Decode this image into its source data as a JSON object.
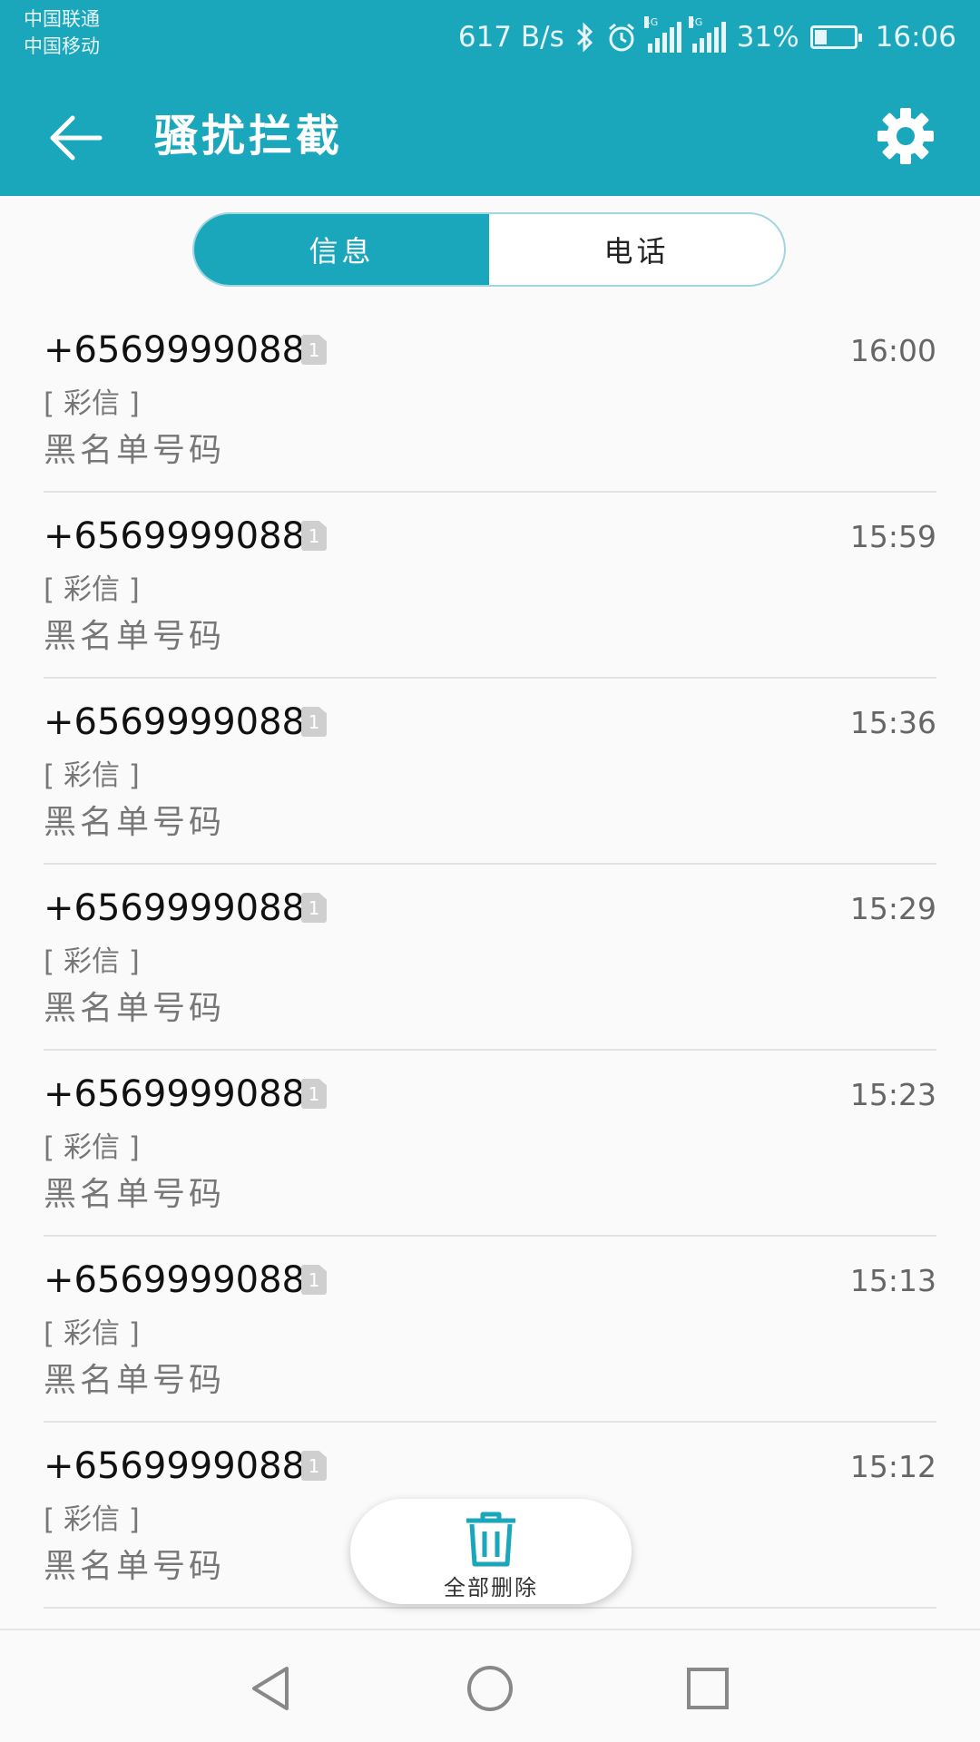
{
  "status_bar": {
    "carrier_1": "中国联通",
    "carrier_2": "中国移动",
    "speed": "617 B/s",
    "net_1": "4G",
    "net_2": "2G",
    "battery": "31%",
    "battery_level": 0.31,
    "time": "16:06",
    "icons": [
      "bluetooth-icon",
      "alarm-icon",
      "signal-icon",
      "battery-icon"
    ]
  },
  "app_bar": {
    "title": "骚扰拦截",
    "back_icon": "arrow-left-icon",
    "settings_icon": "gear-icon"
  },
  "tabs": [
    {
      "label": "信息",
      "selected": true
    },
    {
      "label": "电话",
      "selected": false
    }
  ],
  "messages": [
    {
      "sender": "+6569999088",
      "sim": "1",
      "time": "16:00",
      "type": "[ 彩信 ]",
      "preview": "黑名单号码"
    },
    {
      "sender": "+6569999088",
      "sim": "1",
      "time": "15:59",
      "type": "[ 彩信 ]",
      "preview": "黑名单号码"
    },
    {
      "sender": "+6569999088",
      "sim": "1",
      "time": "15:36",
      "type": "[ 彩信 ]",
      "preview": "黑名单号码"
    },
    {
      "sender": "+6569999088",
      "sim": "1",
      "time": "15:29",
      "type": "[ 彩信 ]",
      "preview": "黑名单号码"
    },
    {
      "sender": "+6569999088",
      "sim": "1",
      "time": "15:23",
      "type": "[ 彩信 ]",
      "preview": "黑名单号码"
    },
    {
      "sender": "+6569999088",
      "sim": "1",
      "time": "15:13",
      "type": "[ 彩信 ]",
      "preview": "黑名单号码"
    },
    {
      "sender": "+6569999088",
      "sim": "1",
      "time": "15:12",
      "type": "[ 彩信 ]",
      "preview": "黑名单号码"
    }
  ],
  "delete_all": {
    "label": "全部删除",
    "icon": "trash-icon"
  },
  "nav_bar": {
    "icons": [
      "back-triangle-icon",
      "home-circle-icon",
      "recents-square-icon"
    ]
  },
  "colors": {
    "accent": "#1aa6bb",
    "background": "#fafafa"
  }
}
